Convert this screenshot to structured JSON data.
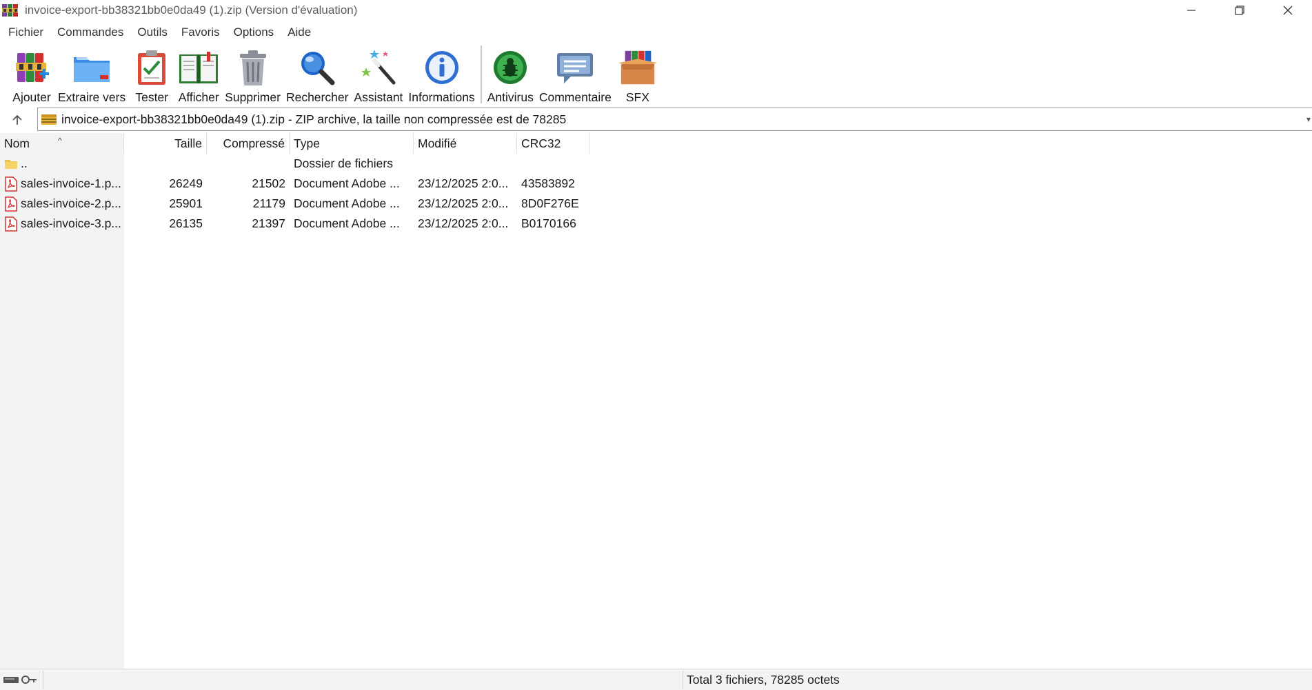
{
  "window": {
    "title": "invoice-export-bb38321bb0e0da49 (1).zip (Version d'évaluation)",
    "icon": "winrar-icon"
  },
  "menu": {
    "items": [
      "Fichier",
      "Commandes",
      "Outils",
      "Favoris",
      "Options",
      "Aide"
    ]
  },
  "toolbar": {
    "buttons": [
      {
        "label": "Ajouter",
        "icon": "add-archive-icon"
      },
      {
        "label": "Extraire vers",
        "icon": "extract-folder-icon"
      },
      {
        "label": "Tester",
        "icon": "test-clipboard-icon"
      },
      {
        "label": "Afficher",
        "icon": "view-book-icon"
      },
      {
        "label": "Supprimer",
        "icon": "trash-icon"
      },
      {
        "label": "Rechercher",
        "icon": "magnifier-icon"
      },
      {
        "label": "Assistant",
        "icon": "wizard-wand-icon"
      },
      {
        "label": "Informations",
        "icon": "info-icon"
      },
      {
        "label": "Antivirus",
        "icon": "antivirus-bug-icon"
      },
      {
        "label": "Commentaire",
        "icon": "comment-bubble-icon"
      },
      {
        "label": "SFX",
        "icon": "sfx-box-icon"
      }
    ]
  },
  "address": {
    "text": "invoice-export-bb38321bb0e0da49 (1).zip - ZIP archive, la taille non compressée est de 78285"
  },
  "columns": {
    "name": "Nom",
    "size": "Taille",
    "packed": "Compressé",
    "type": "Type",
    "modified": "Modifié",
    "crc": "CRC32"
  },
  "rows": [
    {
      "name": "..",
      "size": "",
      "packed": "",
      "type": "Dossier de fichiers",
      "modified": "",
      "crc": "",
      "icon": "folder-icon"
    },
    {
      "name": "sales-invoice-1.p...",
      "size": "26249",
      "packed": "21502",
      "type": "Document Adobe ...",
      "modified": "23/12/2025 2:0...",
      "crc": "43583892",
      "icon": "pdf-icon"
    },
    {
      "name": "sales-invoice-2.p...",
      "size": "25901",
      "packed": "21179",
      "type": "Document Adobe ...",
      "modified": "23/12/2025 2:0...",
      "crc": "8D0F276E",
      "icon": "pdf-icon"
    },
    {
      "name": "sales-invoice-3.p...",
      "size": "26135",
      "packed": "21397",
      "type": "Document Adobe ...",
      "modified": "23/12/2025 2:0...",
      "crc": "B0170166",
      "icon": "pdf-icon"
    }
  ],
  "status": {
    "summary": "Total 3 fichiers, 78285 octets"
  }
}
